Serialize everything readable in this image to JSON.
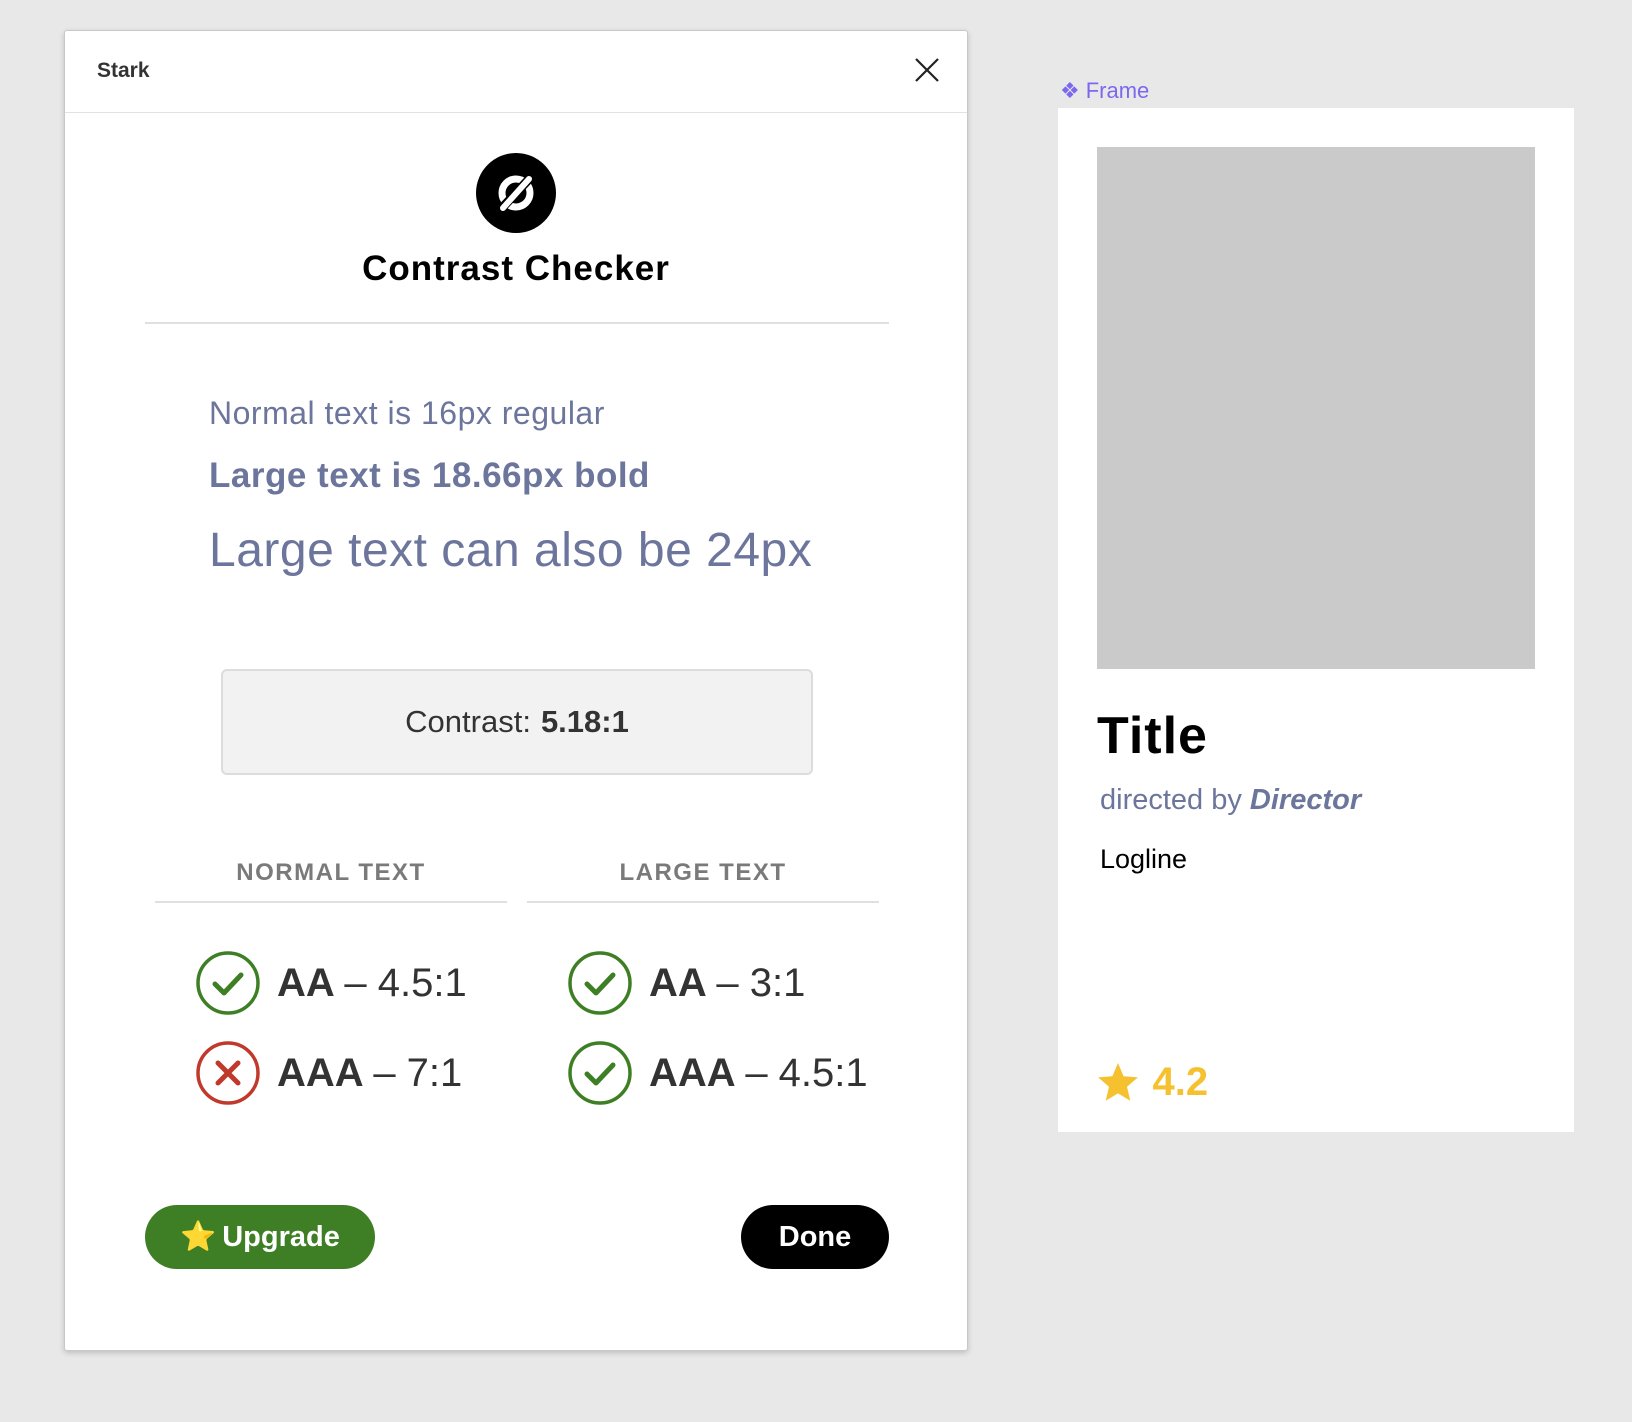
{
  "plugin": {
    "title": "Stark",
    "checker_title": "Contrast Checker",
    "samples": {
      "normal": "Normal text is 16px regular",
      "bold": "Large text is 18.66px bold",
      "large": "Large text can also be 24px"
    },
    "contrast": {
      "label": "Contrast:",
      "value": "5.18:1"
    },
    "columns": {
      "normal": {
        "heading": "NORMAL TEXT",
        "results": [
          {
            "level": "AA",
            "ratio": "– 4.5:1",
            "status": "pass"
          },
          {
            "level": "AAA",
            "ratio": "– 7:1",
            "status": "fail"
          }
        ]
      },
      "large": {
        "heading": "LARGE TEXT",
        "results": [
          {
            "level": "AA",
            "ratio": "– 3:1",
            "status": "pass"
          },
          {
            "level": "AAA",
            "ratio": "– 4.5:1",
            "status": "pass"
          }
        ]
      }
    },
    "buttons": {
      "upgrade_icon": "⭐",
      "upgrade_label": "Upgrade",
      "done_label": "Done"
    },
    "colors": {
      "pass": "#3e7f25",
      "fail": "#c0392b",
      "sample_text": "#6c759b"
    }
  },
  "canvas": {
    "frame_icon": "❖",
    "frame_label": "Frame",
    "card": {
      "title": "Title",
      "director_prefix": "directed by",
      "director_name": "Director",
      "logline": "Logline",
      "rating": "4.2",
      "rating_icon": "star-icon"
    }
  }
}
